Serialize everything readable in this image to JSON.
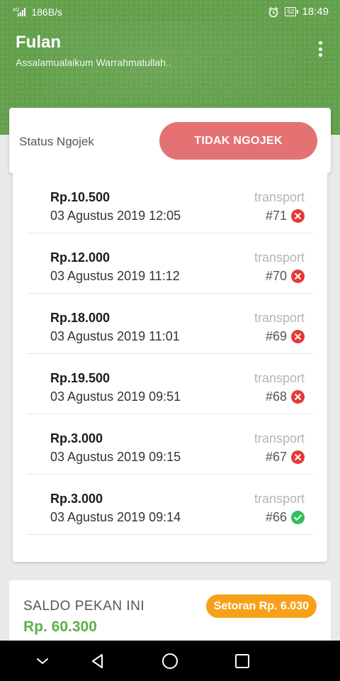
{
  "statusbar": {
    "network_type": "4G",
    "speed": "186B/s",
    "battery": "52",
    "time": "18:49"
  },
  "header": {
    "title": "Fulan",
    "subtitle": "Assalamualaikum Warrahmatullah..",
    "menu_icon": "more-vert-icon"
  },
  "status_card": {
    "label": "Status Ngojek",
    "button_label": "TIDAK NGOJEK"
  },
  "transactions": [
    {
      "amount": "Rp.10.500",
      "date": "03 Agustus 2019 12:05",
      "category": "transport",
      "id": "#71",
      "status": "cancelled"
    },
    {
      "amount": "Rp.12.000",
      "date": "03 Agustus 2019 11:12",
      "category": "transport",
      "id": "#70",
      "status": "cancelled"
    },
    {
      "amount": "Rp.18.000",
      "date": "03 Agustus 2019 11:01",
      "category": "transport",
      "id": "#69",
      "status": "cancelled"
    },
    {
      "amount": "Rp.19.500",
      "date": "03 Agustus 2019 09:51",
      "category": "transport",
      "id": "#68",
      "status": "cancelled"
    },
    {
      "amount": "Rp.3.000",
      "date": "03 Agustus 2019 09:15",
      "category": "transport",
      "id": "#67",
      "status": "cancelled"
    },
    {
      "amount": "Rp.3.000",
      "date": "03 Agustus 2019 09:14",
      "category": "transport",
      "id": "#66",
      "status": "completed"
    }
  ],
  "saldo": {
    "label": "SALDO PEKAN INI",
    "value": "Rp. 60.300",
    "setoran": "Setoran Rp. 6.030"
  },
  "colors": {
    "header": "#63a04c",
    "status_button": "#e57272",
    "cancelled": "#e53935",
    "completed": "#2fbf5a",
    "saldo_value": "#5cb046",
    "setoran_badge": "#f7a11b"
  }
}
